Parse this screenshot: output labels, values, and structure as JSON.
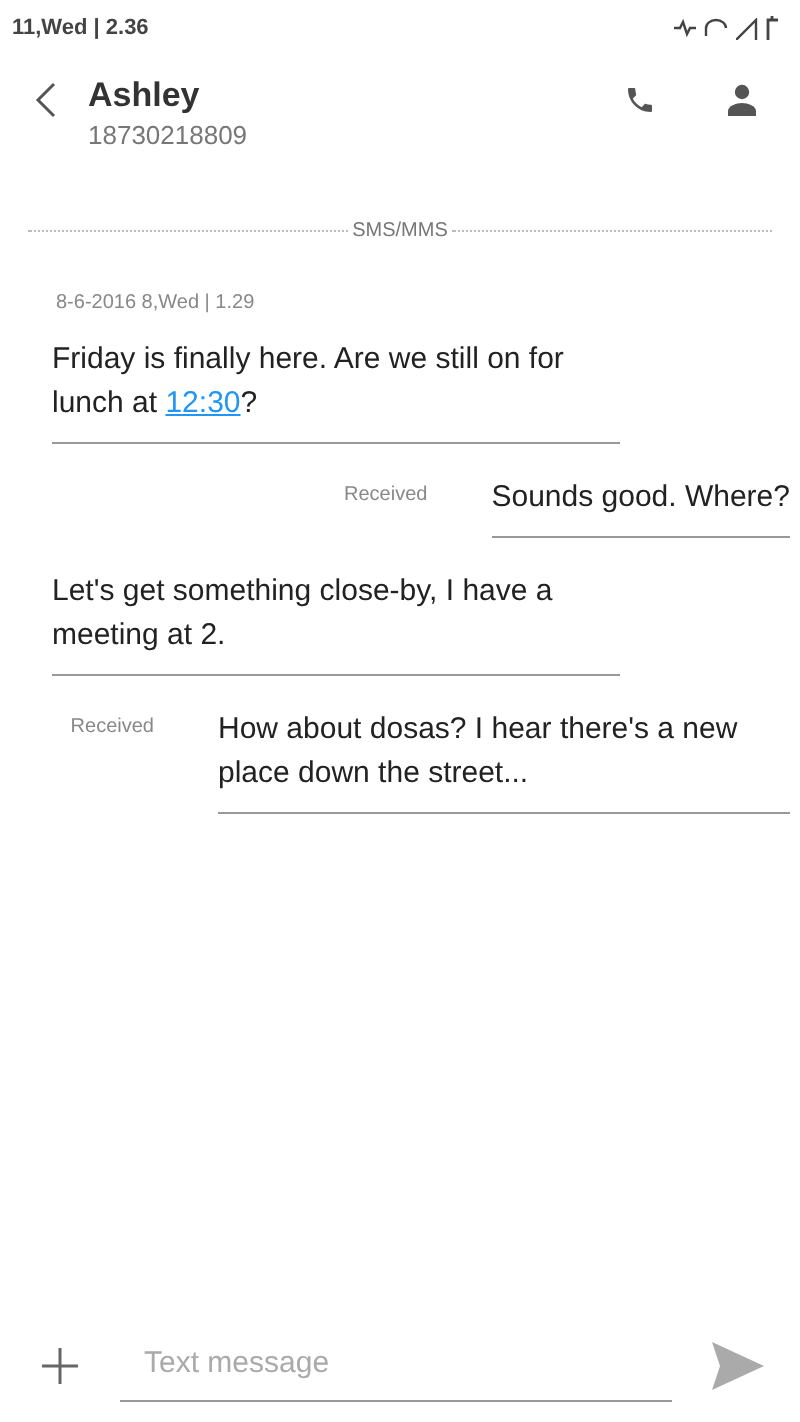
{
  "status_bar": {
    "time": "11,Wed | 2.36"
  },
  "header": {
    "contact_name": "Ashley",
    "phone_number": "18730218809"
  },
  "thread_label": "SMS/MMS",
  "date_stamp": "8-6-2016 8,Wed | 1.29",
  "messages": [
    {
      "kind": "outgoing",
      "parts": [
        {
          "kind": "text",
          "text": "Friday is finally here. Are we still on for lunch at "
        },
        {
          "kind": "link",
          "text": "12:30"
        },
        {
          "kind": "text",
          "text": "?"
        }
      ]
    },
    {
      "kind": "incoming",
      "status": "Received",
      "parts": [
        {
          "kind": "text",
          "text": "Sounds good. Where?"
        }
      ]
    },
    {
      "kind": "outgoing",
      "parts": [
        {
          "kind": "text",
          "text": "Let's get something close-by, I have a meeting at 2."
        }
      ]
    },
    {
      "kind": "incoming",
      "status": "Received",
      "parts": [
        {
          "kind": "text",
          "text": "How about dosas? I hear there's a new place down the street..."
        }
      ]
    }
  ],
  "composer": {
    "placeholder": "Text message"
  }
}
